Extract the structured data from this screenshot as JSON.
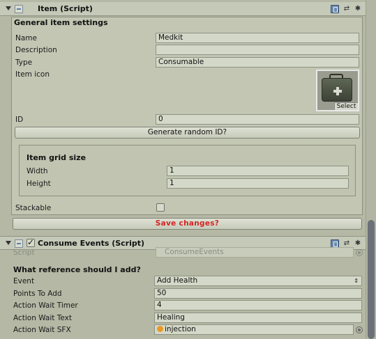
{
  "item_component": {
    "title": "Item (Script)",
    "header_buttons": [
      "book-icon",
      "preset-icon",
      "gear-icon"
    ],
    "general_section_title": "General item settings",
    "fields": {
      "name_label": "Name",
      "name_value": "Medkit",
      "description_label": "Description",
      "description_value": "",
      "type_label": "Type",
      "type_value": "Consumable",
      "item_icon_label": "Item icon",
      "item_icon_select": "Select",
      "id_label": "ID",
      "id_value": "0"
    },
    "generate_id_button": "Generate random ID?",
    "grid_section": {
      "title": "Item grid size",
      "width_label": "Width",
      "width_value": "1",
      "height_label": "Height",
      "height_value": "1"
    },
    "stackable_label": "Stackable",
    "stackable_checked": false,
    "save_button": "Save changes?"
  },
  "consume_component": {
    "title": "Consume Events (Script)",
    "enabled": true,
    "script_label": "Script",
    "script_value": "ConsumeEvents",
    "question": "What reference should I add?",
    "event_label": "Event",
    "event_value": "Add Health",
    "points_label": "Points To Add",
    "points_value": "50",
    "timer_label": "Action Wait Timer",
    "timer_value": "4",
    "text_label": "Action Wait Text",
    "text_value": "Healing",
    "sfx_label": "Action Wait SFX",
    "sfx_value": "injection"
  },
  "colors": {
    "background": "#b4b8a4",
    "save_text": "#d42424",
    "sfx_icon": "#e89a26"
  }
}
